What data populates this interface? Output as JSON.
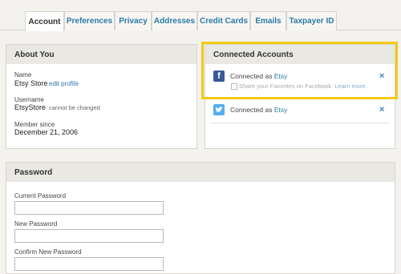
{
  "tabs": [
    {
      "label": "Account"
    },
    {
      "label": "Preferences"
    },
    {
      "label": "Privacy"
    },
    {
      "label": "Addresses"
    },
    {
      "label": "Credit Cards"
    },
    {
      "label": "Emails"
    },
    {
      "label": "Taxpayer ID"
    }
  ],
  "about": {
    "title": "About You",
    "name_label": "Name",
    "name_value": "Etsy Store",
    "edit_profile": "edit profile",
    "username_label": "Username",
    "username_value": "EtsyStore",
    "username_note": "cannot be changed",
    "member_label": "Member since",
    "member_value": "December 21, 2006"
  },
  "connected": {
    "title": "Connected Accounts",
    "facebook": {
      "connected_as": "Connected as",
      "account": "Etsy",
      "share_text": "Share your Favorites on Facebook.",
      "learn_more": "Learn more."
    },
    "twitter": {
      "connected_as": "Connected as",
      "account": "Etsy"
    },
    "remove_glyph": "×"
  },
  "password": {
    "title": "Password",
    "current_label": "Current Password",
    "new_label": "New Password",
    "confirm_label": "Confirm New Password"
  },
  "colors": {
    "link": "#2b7aa6",
    "highlight": "#f2c918",
    "facebook": "#3b5998",
    "twitter": "#55acee"
  }
}
